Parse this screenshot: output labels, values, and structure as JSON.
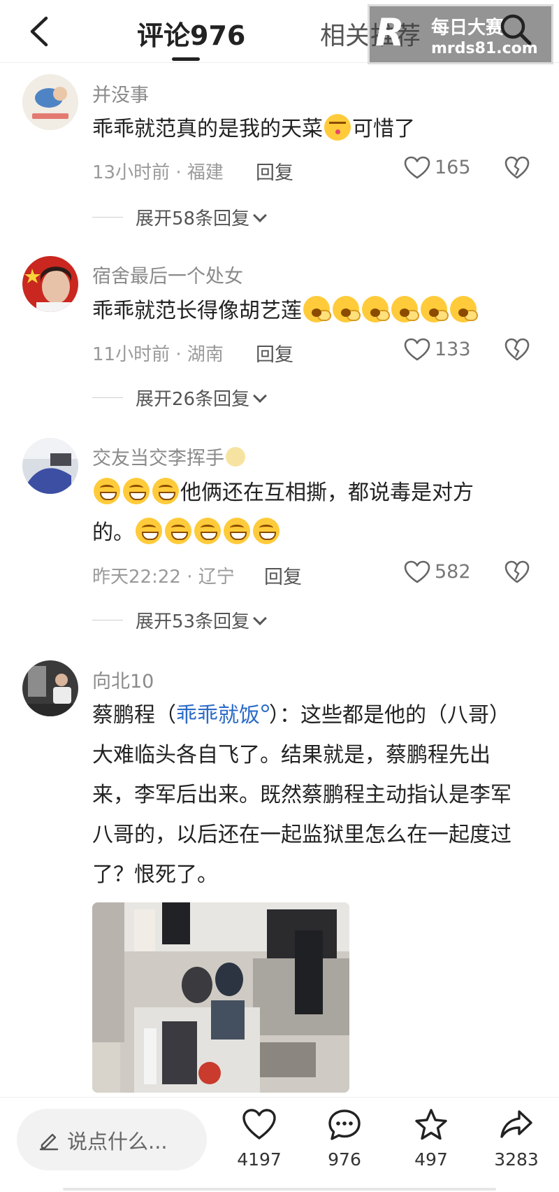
{
  "header": {
    "comments_tab": "评论976",
    "related_tab": "相关推荐",
    "watermark_title": "每日大赛",
    "watermark_url": "mrds81.com",
    "watermark_logo": "R"
  },
  "comments": [
    {
      "username": "并没事",
      "text_before": "乖乖就范真的是我的天菜",
      "text_after": "可惜了",
      "meta": "13小时前 · 福建",
      "reply": "回复",
      "likes": "165",
      "expand": "展开58条回复"
    },
    {
      "username": "宿舍最后一个处女",
      "text_before": "乖乖就范长得像胡艺莲",
      "meta": "11小时前 · 湖南",
      "reply": "回复",
      "likes": "133",
      "expand": "展开26条回复"
    },
    {
      "username": "交友当交李挥手",
      "line1_text": "他俩还在互相撕，都说毒是对方",
      "line2_text": "的。",
      "meta": "昨天22:22 · 辽宁",
      "reply": "回复",
      "likes": "582",
      "expand": "展开53条回复"
    },
    {
      "username": "向北10",
      "text_prefix": "蔡鹏程（",
      "link": "乖乖就饭",
      "text_rest": "）：这些都是他的（八哥）大难临头各自飞了。结果就是，蔡鹏程先出来，李军后出来。既然蔡鹏程主动指认是李军八哥的，以后还在一起监狱里怎么在一起度过了？恨死了。"
    }
  ],
  "bottom_bar": {
    "input_placeholder": "说点什么...",
    "likes": "4197",
    "comments": "976",
    "favorites": "497",
    "shares": "3283"
  },
  "colors": {
    "link": "#2a6ac7",
    "muted": "#9a9a9a",
    "emoji": "#ffcb3a"
  }
}
